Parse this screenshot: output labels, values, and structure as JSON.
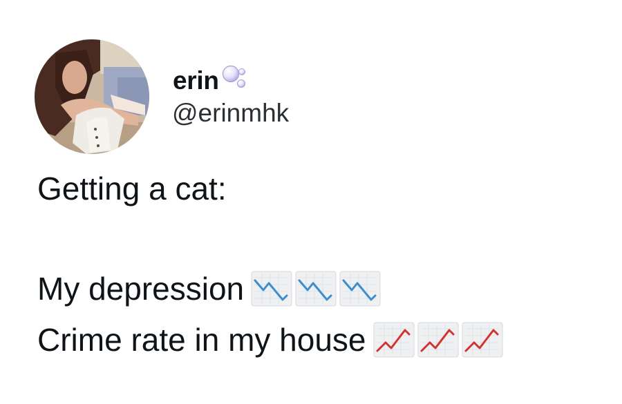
{
  "user": {
    "display_name": "erin",
    "handle": "@erinmhk",
    "name_icon": "bubbles-icon",
    "avatar": "profile-photo-avatar"
  },
  "tweet": {
    "line1": "Getting a cat:",
    "line2": "My depression",
    "line2_emoji": [
      "chart-decreasing-icon",
      "chart-decreasing-icon",
      "chart-decreasing-icon"
    ],
    "line3": "Crime rate in my house",
    "line3_emoji": [
      "chart-increasing-icon",
      "chart-increasing-icon",
      "chart-increasing-icon"
    ]
  },
  "colors": {
    "text": "#0f1419",
    "handle": "#2b2f33",
    "decreasing_line": "#3b8fd0",
    "increasing_line": "#d2332d",
    "emoji_bg": "#eef0f2"
  }
}
